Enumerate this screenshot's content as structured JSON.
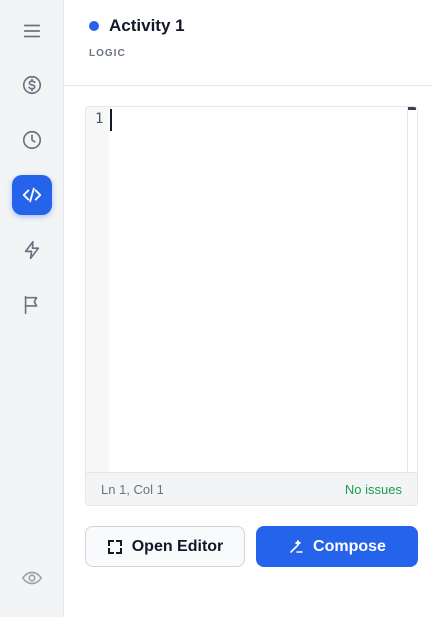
{
  "header": {
    "title": "Activity 1",
    "subtitle": "LOGIC"
  },
  "sidebar": {
    "items": [
      {
        "icon": "menu-icon",
        "active": false
      },
      {
        "icon": "dollar-icon",
        "active": false
      },
      {
        "icon": "clock-icon",
        "active": false
      },
      {
        "icon": "code-icon",
        "active": true
      },
      {
        "icon": "lightning-icon",
        "active": false
      },
      {
        "icon": "flag-icon",
        "active": false
      },
      {
        "icon": "eye-icon",
        "active": false
      }
    ]
  },
  "editor": {
    "line_numbers": [
      "1"
    ],
    "content": "",
    "cursor_position": "Ln 1, Col 1",
    "issues": "No issues"
  },
  "actions": {
    "open_editor_label": "Open Editor",
    "compose_label": "Compose"
  },
  "colors": {
    "accent": "#2563eb",
    "success": "#16a34a"
  }
}
